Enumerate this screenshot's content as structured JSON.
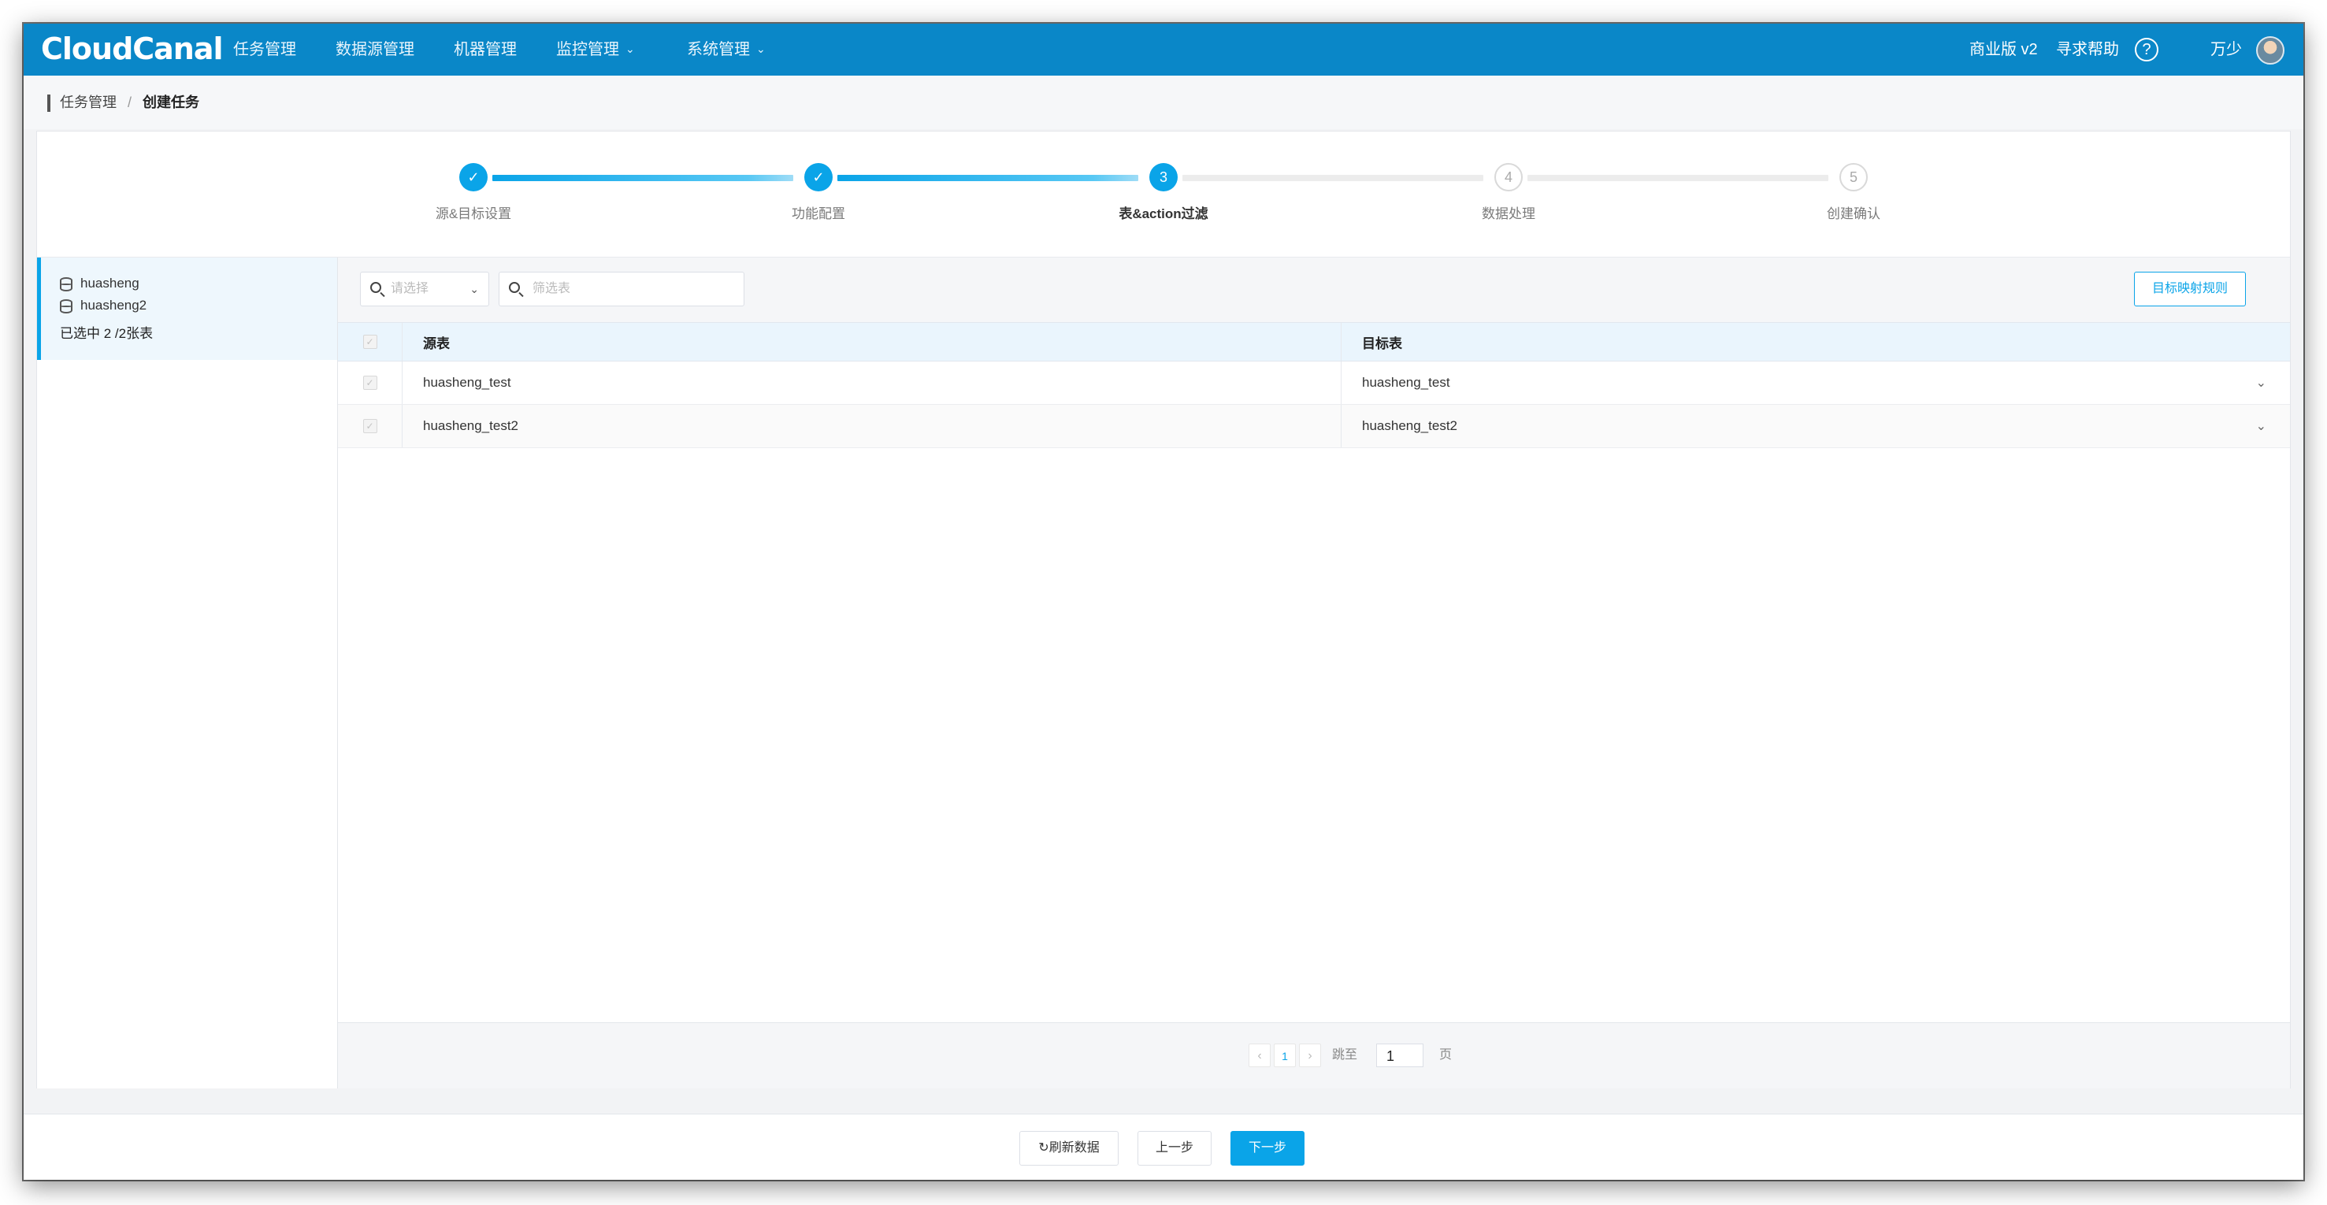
{
  "app": {
    "logo": "CloudCanal",
    "nav": [
      {
        "label": "任务管理",
        "dropdown": false
      },
      {
        "label": "数据源管理",
        "dropdown": false
      },
      {
        "label": "机器管理",
        "dropdown": false
      },
      {
        "label": "监控管理",
        "dropdown": true
      },
      {
        "label": "系统管理",
        "dropdown": true
      }
    ],
    "edition": "商业版 v2",
    "help_link": "寻求帮助",
    "help_icon": "?",
    "user": "万少",
    "accent": "#0a87c8"
  },
  "breadcrumb": {
    "parent": "任务管理",
    "separator": "/",
    "current": "创建任务"
  },
  "steps": [
    {
      "label": "源&目标设置",
      "state": "done",
      "index": "1"
    },
    {
      "label": "功能配置",
      "state": "done",
      "index": "2"
    },
    {
      "label": "表&action过滤",
      "state": "current",
      "index": "3"
    },
    {
      "label": "数据处理",
      "state": "todo",
      "index": "4"
    },
    {
      "label": "创建确认",
      "state": "todo",
      "index": "5"
    }
  ],
  "left": {
    "databases": [
      "huasheng",
      "huasheng2"
    ],
    "summary": "已选中 2 /2张表"
  },
  "filters": {
    "select_placeholder": "请选择",
    "search_placeholder": "筛选表",
    "mapping_button": "目标映射规则"
  },
  "table": {
    "headers": {
      "source": "源表",
      "target": "目标表"
    },
    "rows": [
      {
        "source": "huasheng_test",
        "target": "huasheng_test"
      },
      {
        "source": "huasheng_test2",
        "target": "huasheng_test2"
      }
    ]
  },
  "pager": {
    "prev": "‹",
    "current": "1",
    "next": "›",
    "jump_label": "跳至",
    "jump_value": "1",
    "page_unit": "页"
  },
  "footer": {
    "refresh": "刷新数据",
    "prev": "上一步",
    "next": "下一步"
  }
}
